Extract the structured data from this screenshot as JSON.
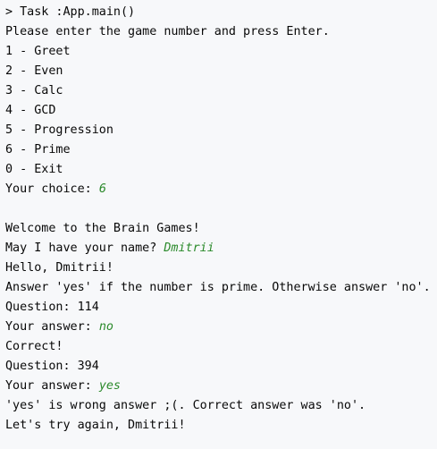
{
  "console": {
    "task_line": "> Task :App.main()",
    "prompt": "Please enter the game number and press Enter.",
    "menu": [
      "1 - Greet",
      "2 - Even",
      "3 - Calc",
      "4 - GCD",
      "5 - Progression",
      "6 - Prime",
      "0 - Exit"
    ],
    "choice_label": "Your choice: ",
    "choice_value": "6",
    "welcome": "Welcome to the Brain Games!",
    "name_prompt": "May I have your name? ",
    "name_value": "Dmitrii",
    "hello": "Hello, Dmitrii!",
    "rules": "Answer 'yes' if the number is prime. Otherwise answer 'no'.",
    "question1": "Question: 114",
    "answer_label": "Your answer: ",
    "answer1": "no",
    "correct": "Correct!",
    "question2": "Question: 394",
    "answer2": "yes",
    "wrong": "'yes' is wrong answer ;(. Correct answer was 'no'.",
    "retry": "Let's try again, Dmitrii!"
  },
  "colors": {
    "background": "#f7f8fa",
    "text": "#080808",
    "user_input": "#2b8a2b"
  }
}
